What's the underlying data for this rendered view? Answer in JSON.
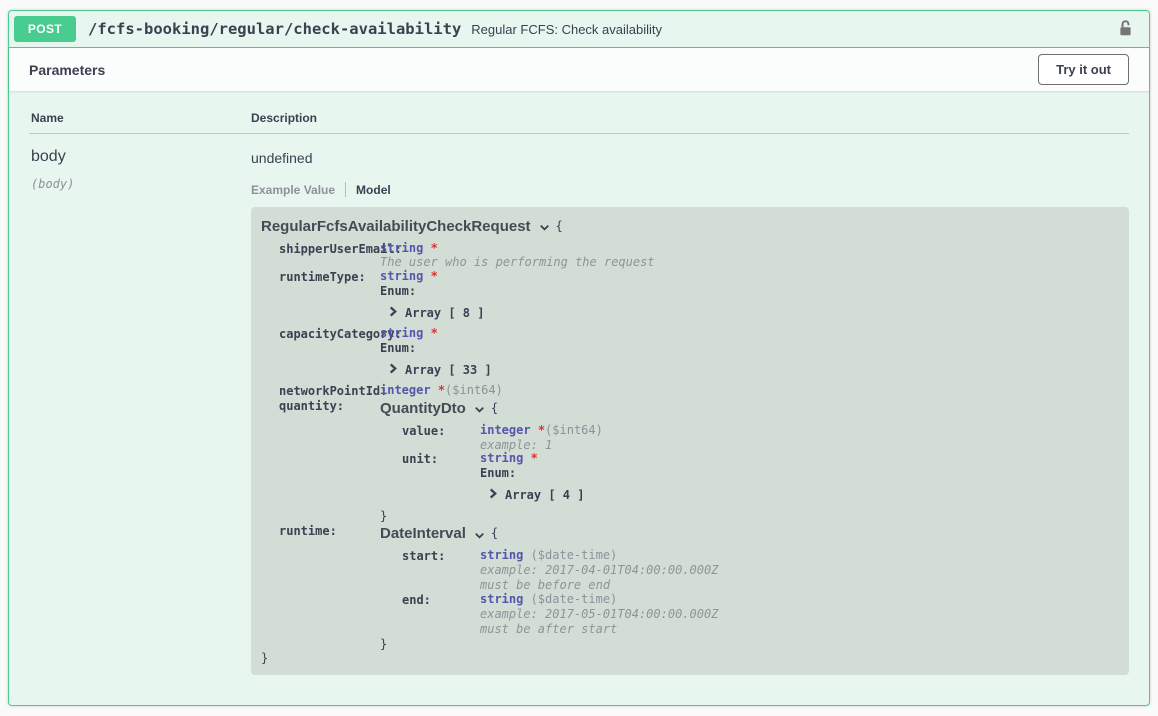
{
  "colors": {
    "accent-green": "#49cc90",
    "opblock-bg": "#e7f6ef",
    "section-header-bg": "#fbfdfc",
    "model-box-bg": "#d2ddd6",
    "text": "#3b4151",
    "type-blue": "#5555aa",
    "required-red": "#df3030",
    "muted": "#8f9199",
    "page-bg": "#fafafa",
    "lock-gray": "#767676"
  },
  "icons": {
    "lock": "unlocked-padlock",
    "model_toggle": "chevron-down",
    "enum_toggle": "chevron-right"
  },
  "endpoint": {
    "method": "POST",
    "path": "/fcfs-booking/regular/check-availability",
    "summary": "Regular FCFS: Check availability"
  },
  "parameters_panel": {
    "title": "Parameters",
    "try_it_out_label": "Try it out",
    "table": {
      "name_header": "Name",
      "description_header": "Description",
      "row": {
        "name": "body",
        "name_sub": "(body)",
        "description": "undefined"
      }
    },
    "tabs": [
      {
        "label": "Example Value",
        "active": false
      },
      {
        "label": "Model",
        "active": true
      }
    ]
  },
  "model": {
    "title": "RegularFcfsAvailabilityCheckRequest",
    "brace_open": "{",
    "brace_close": "}",
    "properties": [
      {
        "name": "shipperUserEmail:",
        "type": "string",
        "required": "*",
        "description": "The user who is performing the request"
      },
      {
        "name": "runtimeType:",
        "type": "string",
        "required": "*",
        "enum_label": "Enum:",
        "enum_value": "Array [ 8 ]"
      },
      {
        "name": "capacityCategory:",
        "type": "string",
        "required": "*",
        "enum_label": "Enum:",
        "enum_value": "Array [ 33 ]"
      },
      {
        "name": "networkPointId:",
        "type": "integer",
        "required": "*",
        "format": "($int64)"
      },
      {
        "name": "quantity:",
        "nested": {
          "title": "QuantityDto",
          "brace_open": "{",
          "brace_close": "}",
          "properties": [
            {
              "name": "value:",
              "type": "integer",
              "required": "*",
              "format": "($int64)",
              "example": "example: 1"
            },
            {
              "name": "unit:",
              "type": "string",
              "required": "*",
              "enum_label": "Enum:",
              "enum_value": "Array [ 4 ]"
            }
          ]
        }
      },
      {
        "name": "runtime:",
        "nested": {
          "title": "DateInterval",
          "brace_open": "{",
          "brace_close": "}",
          "properties": [
            {
              "name": "start:",
              "type": "string",
              "format": " ($date-time)",
              "example": "example: 2017-04-01T04:00:00.000Z",
              "note": "must be before end"
            },
            {
              "name": "end:",
              "type": "string",
              "format": " ($date-time)",
              "example": "example: 2017-05-01T04:00:00.000Z",
              "note": "must be after start"
            }
          ]
        }
      }
    ]
  }
}
